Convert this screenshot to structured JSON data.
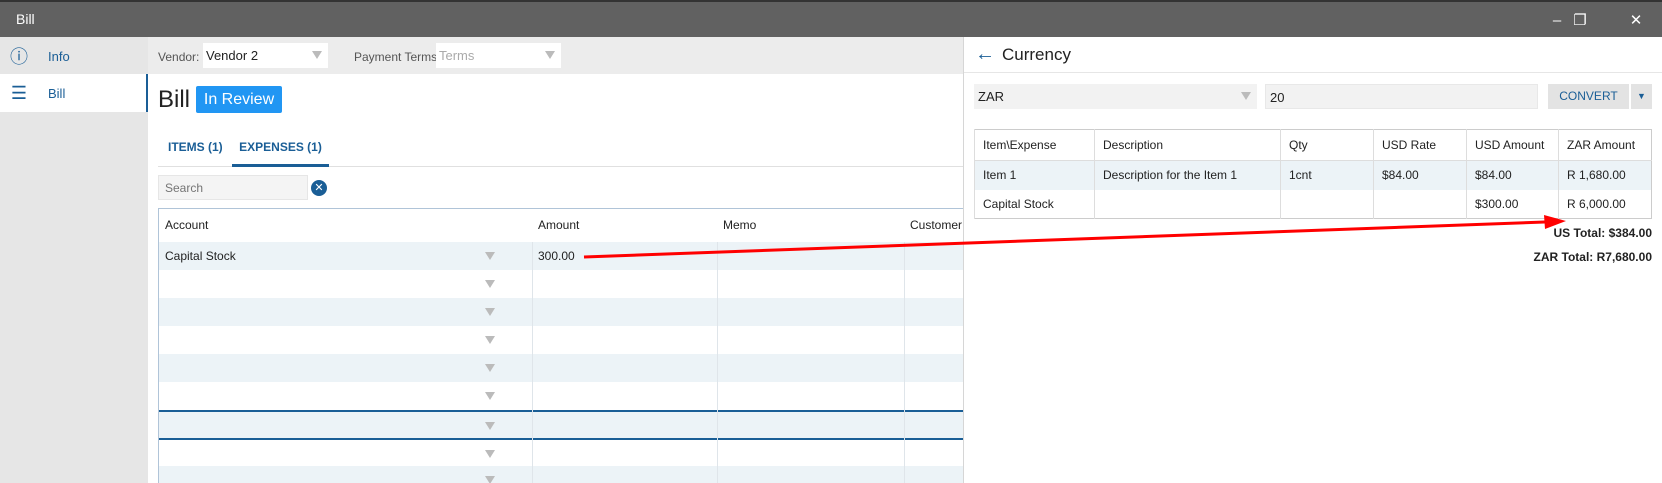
{
  "window": {
    "title": "Bill",
    "minimize": "–",
    "restore": "❐",
    "close": "✕"
  },
  "sidebar": {
    "items": [
      {
        "label": "Info",
        "icon": "info-icon"
      },
      {
        "label": "Bill",
        "icon": "list-icon"
      }
    ]
  },
  "toolbar": {
    "vendor_label": "Vendor:",
    "vendor_value": "Vendor 2",
    "terms_label": "Payment Terms:",
    "terms_placeholder": "Terms"
  },
  "bill": {
    "title": "Bill",
    "status": "In Review",
    "tabs": [
      "ITEMS (1)",
      "EXPENSES (1)"
    ],
    "search_placeholder": "Search",
    "grid": {
      "columns": [
        "Account",
        "Amount",
        "Memo",
        "Customer"
      ],
      "rows": [
        {
          "account": "Capital Stock",
          "amount": "300.00"
        }
      ]
    }
  },
  "currency": {
    "title": "Currency",
    "currency_value": "ZAR",
    "rate_value": "20",
    "convert_label": "CONVERT",
    "table": {
      "columns": [
        "Item\\Expense",
        "Description",
        "Qty",
        "USD Rate",
        "USD Amount",
        "ZAR Amount"
      ],
      "rows": [
        [
          "Item 1",
          "Description for the Item 1",
          "1cnt",
          "$84.00",
          "$84.00",
          "R 1,680.00"
        ],
        [
          "Capital Stock",
          "",
          "",
          "",
          "$300.00",
          "R 6,000.00"
        ]
      ]
    },
    "us_total": "US Total: $384.00",
    "zar_total": "ZAR Total: R7,680.00"
  },
  "colors": {
    "accent": "#1a5e96",
    "badge": "#2196f3",
    "annotation": "#ff0000"
  }
}
